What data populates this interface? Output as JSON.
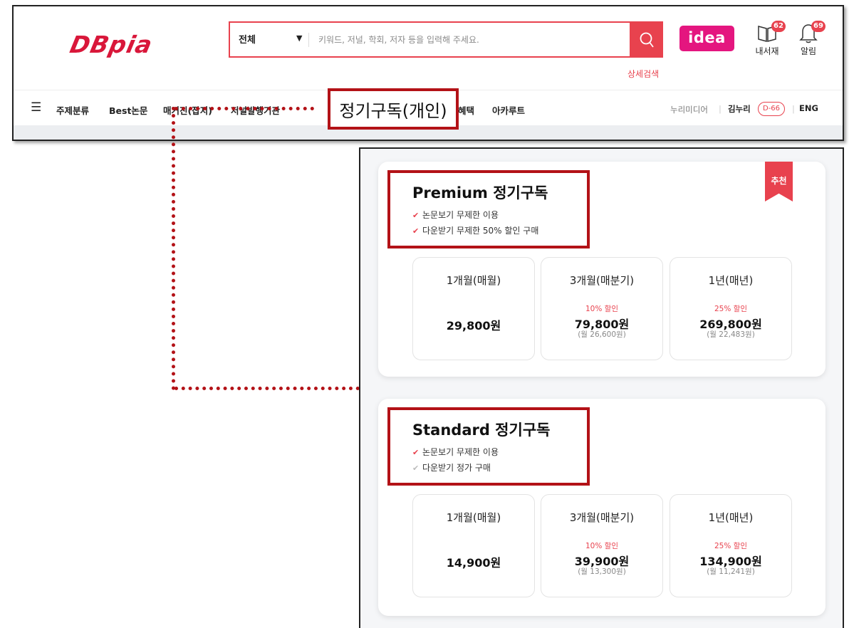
{
  "header": {
    "logo": "DBpia",
    "search": {
      "scope": "전체",
      "placeholder": "키워드, 저널, 학회, 저자 등을 입력해 주세요."
    },
    "advanced_search": "상세검색",
    "idea": "idea",
    "library": {
      "label": "내서재",
      "badge": "62"
    },
    "alerts": {
      "label": "알림",
      "badge": "69"
    }
  },
  "nav": {
    "items": [
      "주제분류",
      "Best논문",
      "매거진(잡지)",
      "저널발행기관",
      "혜택",
      "아카루트"
    ],
    "callout": "정기구독(개인)",
    "right": {
      "institution": "누리미디어",
      "user": "김누리",
      "dday": "D-66",
      "lang": "ENG"
    }
  },
  "plans": [
    {
      "title": "Premium 정기구독",
      "ribbon": "추천",
      "features": [
        {
          "text": "논문보기 무제한 이용",
          "checked": true
        },
        {
          "text": "다운받기 무제한 50% 할인 구매",
          "checked": true
        }
      ],
      "options": [
        {
          "name": "1개월(매월)",
          "discount": "",
          "price": "29,800원",
          "monthly": ""
        },
        {
          "name": "3개월(매분기)",
          "discount": "10% 할인",
          "price": "79,800원",
          "monthly": "(월 26,600원)"
        },
        {
          "name": "1년(매년)",
          "discount": "25% 할인",
          "price": "269,800원",
          "monthly": "(월 22,483원)"
        }
      ]
    },
    {
      "title": "Standard 정기구독",
      "features": [
        {
          "text": "논문보기 무제한 이용",
          "checked": true
        },
        {
          "text": "다운받기 정가 구매",
          "checked": false
        }
      ],
      "options": [
        {
          "name": "1개월(매월)",
          "discount": "",
          "price": "14,900원",
          "monthly": ""
        },
        {
          "name": "3개월(매분기)",
          "discount": "10% 할인",
          "price": "39,900원",
          "monthly": "(월 13,300원)"
        },
        {
          "name": "1년(매년)",
          "discount": "25% 할인",
          "price": "134,900원",
          "monthly": "(월 11,241원)"
        }
      ]
    }
  ],
  "colors": {
    "accent": "#e8424e",
    "callout": "#b31217",
    "idea": "#e4167f"
  }
}
